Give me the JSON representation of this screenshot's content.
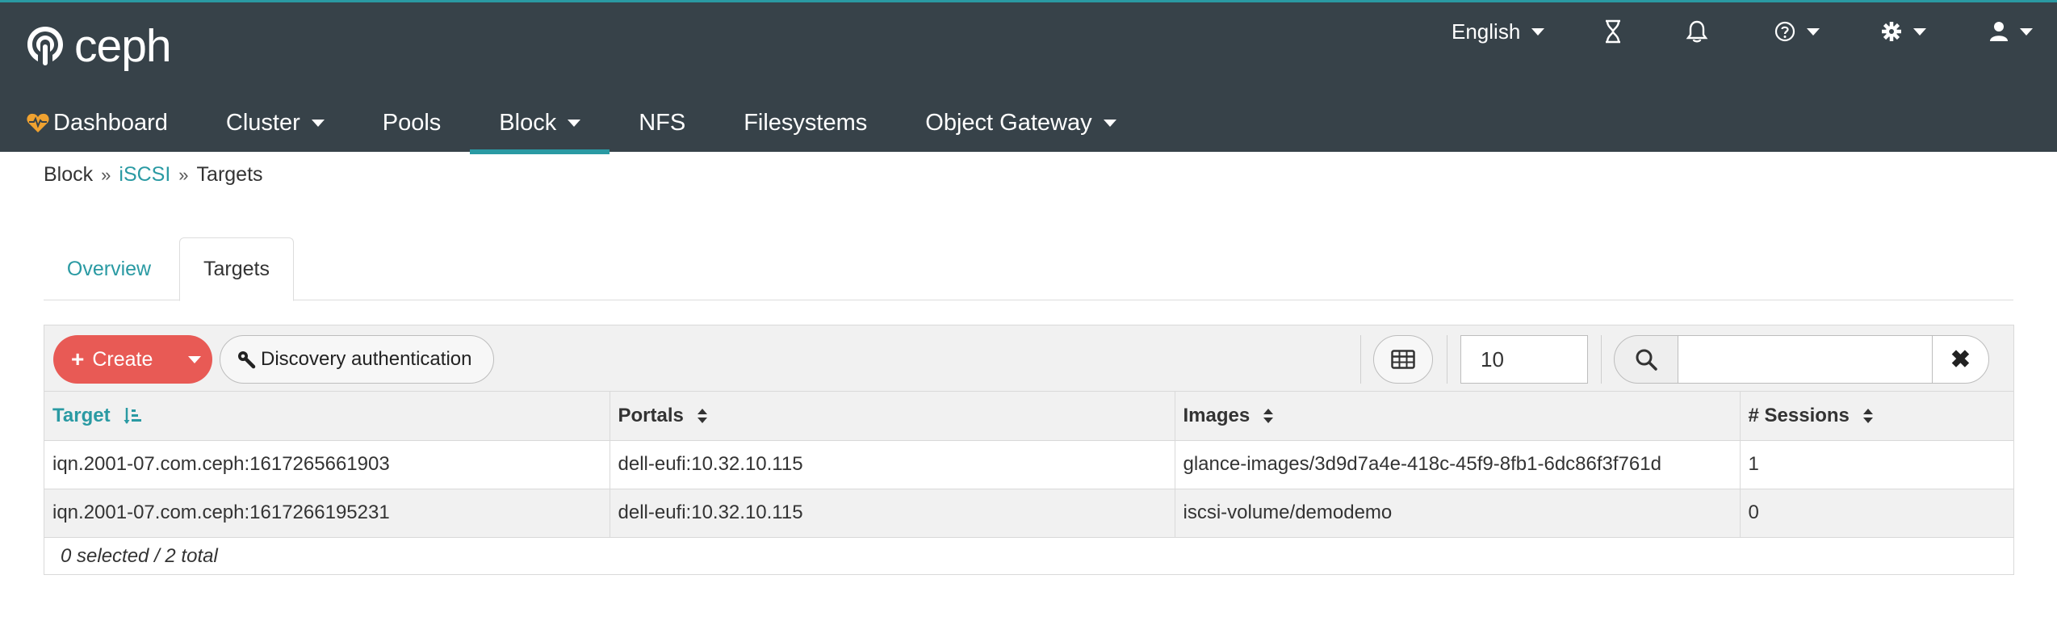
{
  "app": {
    "brand": "ceph",
    "accent": "#2a9aa3",
    "navbar_bg": "#374249",
    "create_color": "#e85a55"
  },
  "utility": {
    "language": "English",
    "icons": [
      "hourglass-icon",
      "bell-icon",
      "help-icon",
      "gear-icon",
      "user-icon"
    ]
  },
  "nav": {
    "items": [
      {
        "label": "Dashboard"
      },
      {
        "label": "Cluster"
      },
      {
        "label": "Pools"
      },
      {
        "label": "Block"
      },
      {
        "label": "NFS"
      },
      {
        "label": "Filesystems"
      },
      {
        "label": "Object Gateway"
      }
    ],
    "active": "Block"
  },
  "breadcrumb": {
    "items": [
      "Block",
      "iSCSI",
      "Targets"
    ]
  },
  "tabs": [
    {
      "label": "Overview"
    },
    {
      "label": "Targets"
    }
  ],
  "active_tab": "Targets",
  "toolbar": {
    "create_label": "Create",
    "discovery_label": "Discovery authentication",
    "page_size": "10",
    "search_value": ""
  },
  "table": {
    "columns": [
      "Target",
      "Portals",
      "Images",
      "# Sessions"
    ],
    "sorted_column": "Target",
    "rows": [
      [
        "iqn.2001-07.com.ceph:1617265661903",
        "dell-eufi:10.32.10.115",
        "glance-images/3d9d7a4e-418c-45f9-8fb1-6dc86f3f761d",
        "1"
      ],
      [
        "iqn.2001-07.com.ceph:1617266195231",
        "dell-eufi:10.32.10.115",
        "iscsi-volume/demodemo",
        "0"
      ]
    ],
    "footer": "0 selected / 2 total"
  }
}
